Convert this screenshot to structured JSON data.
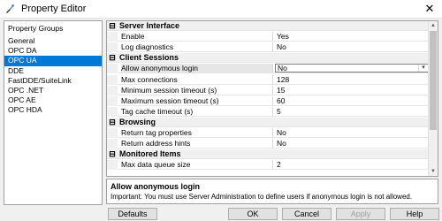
{
  "window": {
    "title": "Property Editor"
  },
  "groups": {
    "header": "Property Groups",
    "items": [
      "General",
      "OPC DA",
      "OPC UA",
      "DDE",
      "FastDDE/SuiteLink",
      "OPC .NET",
      "OPC AE",
      "OPC HDA"
    ],
    "selected_index": 2
  },
  "grid": {
    "rows": [
      {
        "type": "category",
        "label": "Server Interface"
      },
      {
        "type": "property",
        "name": "Enable",
        "value": "Yes"
      },
      {
        "type": "property",
        "name": "Log diagnostics",
        "value": "No"
      },
      {
        "type": "category",
        "label": "Client Sessions"
      },
      {
        "type": "property",
        "name": "Allow anonymous login",
        "value": "No",
        "selected": true,
        "dropdown": true
      },
      {
        "type": "property",
        "name": "Max connections",
        "value": "128"
      },
      {
        "type": "property",
        "name": "Minimum session timeout (s)",
        "value": "15"
      },
      {
        "type": "property",
        "name": "Maximum session timeout (s)",
        "value": "60"
      },
      {
        "type": "property",
        "name": "Tag cache timeout (s)",
        "value": "5"
      },
      {
        "type": "category",
        "label": "Browsing"
      },
      {
        "type": "property",
        "name": "Return tag properties",
        "value": "No"
      },
      {
        "type": "property",
        "name": "Return address hints",
        "value": "No"
      },
      {
        "type": "category",
        "label": "Monitored Items"
      },
      {
        "type": "property",
        "name": "Max data queue size",
        "value": "2"
      }
    ]
  },
  "description": {
    "title": "Allow anonymous login",
    "text": "Important: You must use Server Administration to define users if anonymous login is not allowed."
  },
  "buttons": {
    "defaults": "Defaults",
    "ok": "OK",
    "cancel": "Cancel",
    "apply": "Apply",
    "help": "Help"
  },
  "icons": {
    "collapse": "⊟",
    "dropdown_arrow": "▾",
    "scroll_up": "▲",
    "scroll_down": "▼",
    "close": "✕"
  }
}
